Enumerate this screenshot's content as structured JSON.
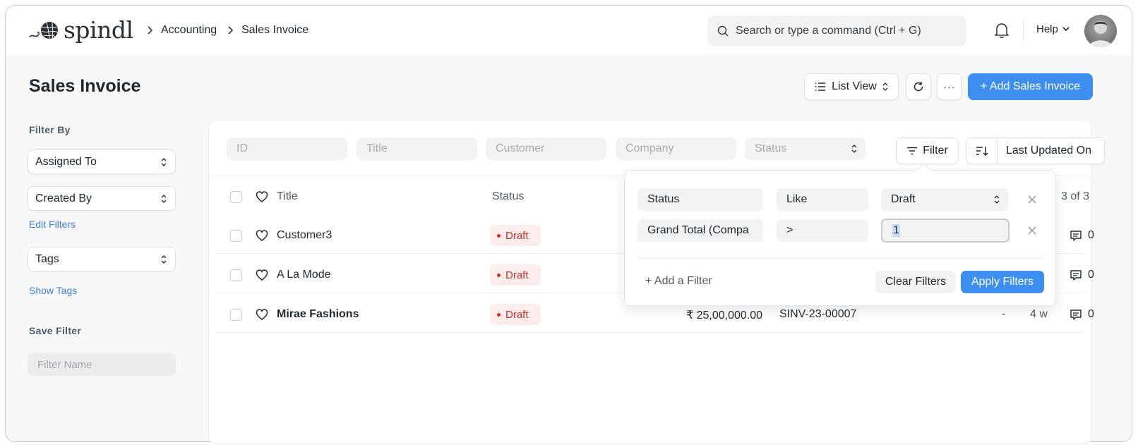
{
  "app": {
    "name": "spindl"
  },
  "breadcrumb": [
    "Accounting",
    "Sales Invoice"
  ],
  "search": {
    "placeholder": "Search or type a command (Ctrl + G)"
  },
  "nav": {
    "help_label": "Help"
  },
  "page": {
    "title": "Sales Invoice"
  },
  "toolbar": {
    "view_label": "List View",
    "more_label": "···",
    "add_label": "+ Add Sales Invoice"
  },
  "sidebar": {
    "filter_by_heading": "Filter By",
    "assigned_to": "Assigned To",
    "created_by": "Created By",
    "edit_filters": "Edit Filters",
    "tags": "Tags",
    "show_tags": "Show Tags",
    "save_filter_heading": "Save Filter",
    "filter_name_placeholder": "Filter Name"
  },
  "list_filters": {
    "id": "ID",
    "title": "Title",
    "customer": "Customer",
    "company": "Company",
    "status": "Status",
    "filter_button": "Filter",
    "sort_label": "Last Updated On"
  },
  "table": {
    "columns": {
      "title": "Title",
      "status": "Status"
    },
    "count": "3 of 3",
    "rows": [
      {
        "title": "Customer3",
        "status": "Draft",
        "amount": "",
        "id": "",
        "dash": "",
        "age": "",
        "comments": "0"
      },
      {
        "title": "A La Mode",
        "status": "Draft",
        "amount": "",
        "id": "",
        "dash": "",
        "age": "",
        "comments": "0"
      },
      {
        "title": "Mirae Fashions",
        "status": "Draft",
        "amount": "₹ 25,00,000.00",
        "id": "SINV-23-00007",
        "dash": "-",
        "age": "4 w",
        "comments": "0"
      }
    ]
  },
  "filter_popover": {
    "rows": [
      {
        "field": "Status",
        "operator": "Like",
        "value": "Draft"
      },
      {
        "field": "Grand Total (Compa",
        "operator": ">",
        "value": "1"
      }
    ],
    "add_filter": "+ Add a Filter",
    "clear_label": "Clear Filters",
    "apply_label": "Apply Filters"
  },
  "colors": {
    "primary": "#3e8ef0",
    "draft_text": "#c7322f",
    "draft_bg": "#fdecec",
    "link": "#3a80e0"
  }
}
